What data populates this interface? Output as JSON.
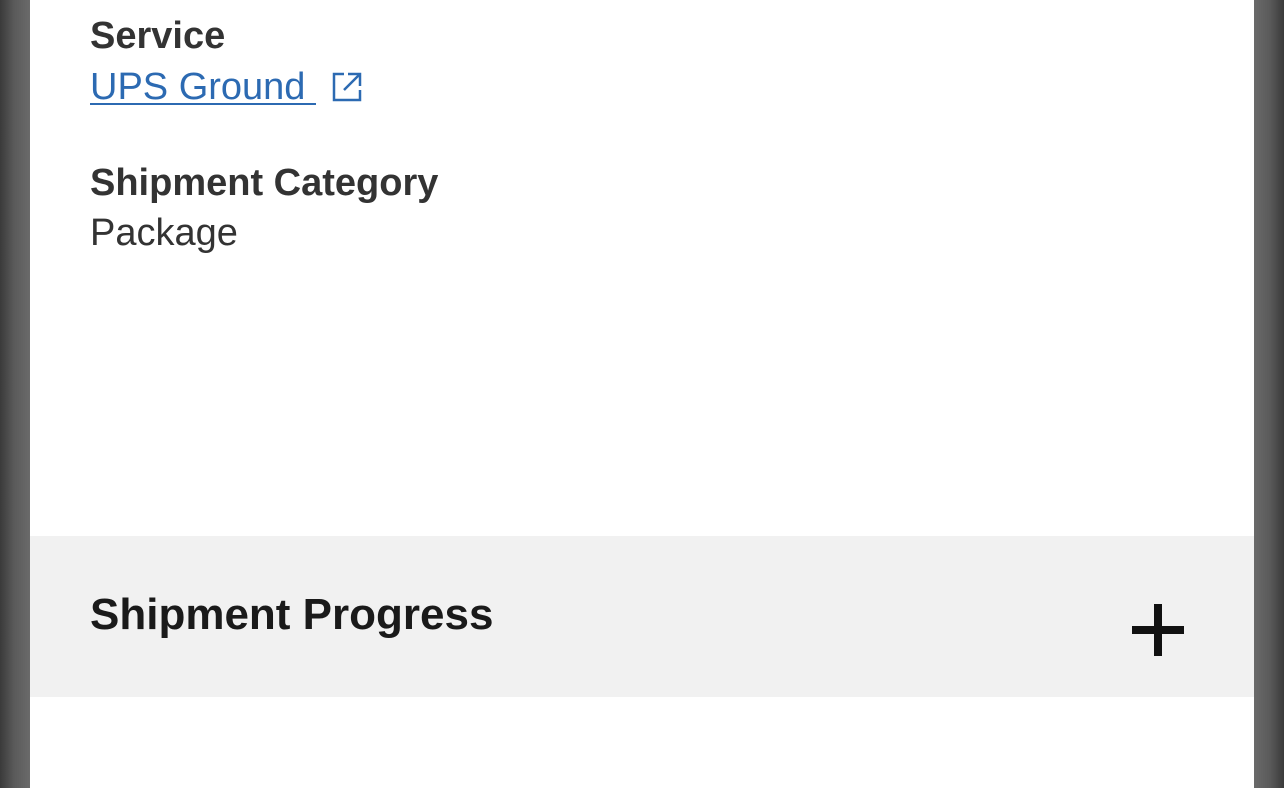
{
  "details": {
    "service_label": "Service",
    "service_value": "UPS Ground ",
    "service_link_icon": "external-link-icon",
    "category_label": "Shipment Category",
    "category_value": "Package"
  },
  "accordion": {
    "title": "Shipment Progress",
    "toggle_icon": "plus-icon"
  },
  "colors": {
    "link": "#2c6ab2",
    "text": "#333333",
    "accordion_bg": "#f1f1f1"
  }
}
